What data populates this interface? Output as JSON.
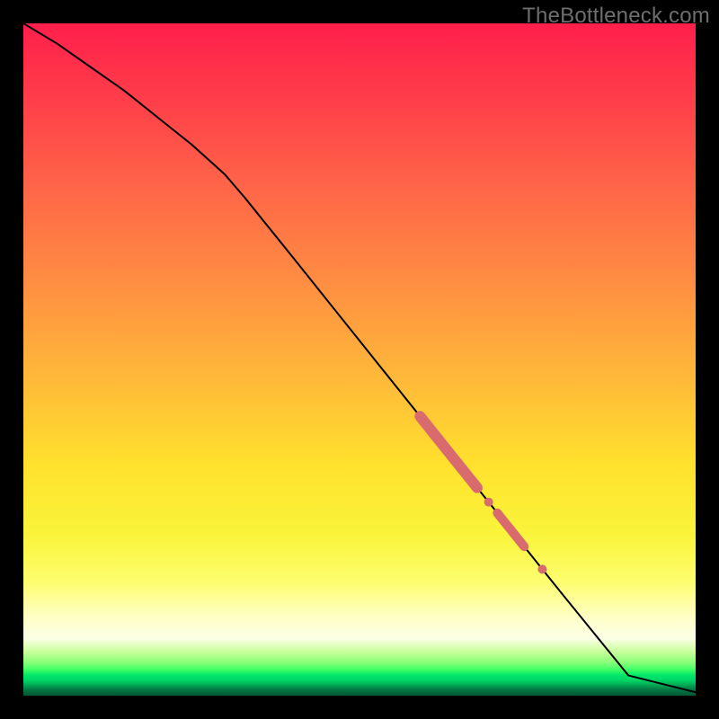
{
  "watermark": "TheBottleneck.com",
  "colors": {
    "square_border_black": "#000000",
    "line_black": "#000000",
    "dot_pink": "#d96b6e"
  },
  "chart_data": {
    "type": "line",
    "title": "",
    "xlabel": "",
    "ylabel": "",
    "xlim": [
      0,
      100
    ],
    "ylim": [
      0,
      100
    ],
    "grid": false,
    "series": [
      {
        "name": "curve",
        "x": [
          0,
          5,
          10,
          15,
          20,
          25,
          30,
          33,
          40,
          50,
          60,
          70,
          80,
          90,
          100
        ],
        "y": [
          100,
          97,
          93.5,
          90,
          86,
          82,
          77.5,
          74,
          65.3,
          52.8,
          40.3,
          27.8,
          15.3,
          3.0,
          0.5
        ]
      }
    ],
    "annotations": [
      {
        "kind": "thick-segment",
        "x_start": 59,
        "x_end": 67.5
      },
      {
        "kind": "dot",
        "x": 69.2
      },
      {
        "kind": "thick-segment",
        "x_start": 70.5,
        "x_end": 74.5
      },
      {
        "kind": "dot",
        "x": 77.2
      }
    ]
  }
}
